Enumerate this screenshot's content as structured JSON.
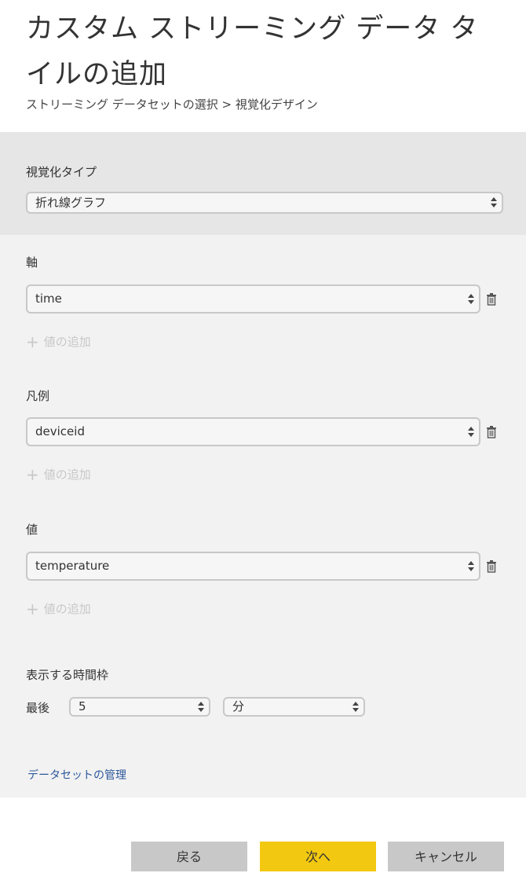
{
  "title": "カスタム ストリーミング データ タイルの追加",
  "breadcrumb": "ストリーミング データセットの選択 > 視覚化デザイン",
  "visualization": {
    "label": "視覚化タイプ",
    "value": "折れ線グラフ"
  },
  "axis": {
    "label": "軸",
    "value": "time",
    "add_value": "値の追加"
  },
  "legend": {
    "label": "凡例",
    "value": "deviceid",
    "add_value": "値の追加"
  },
  "values": {
    "label": "値",
    "value": "temperature",
    "add_value": "値の追加"
  },
  "time_window": {
    "label": "表示する時間枠",
    "prefix": "最後",
    "amount": "5",
    "unit": "分"
  },
  "manage_link": "データセットの管理",
  "buttons": {
    "back": "戻る",
    "next": "次へ",
    "cancel": "キャンセル"
  },
  "colors": {
    "accent": "#f2c811",
    "link": "#2b579a",
    "panel_top": "#e6e6e6",
    "panel_main": "#f2f2f2"
  }
}
